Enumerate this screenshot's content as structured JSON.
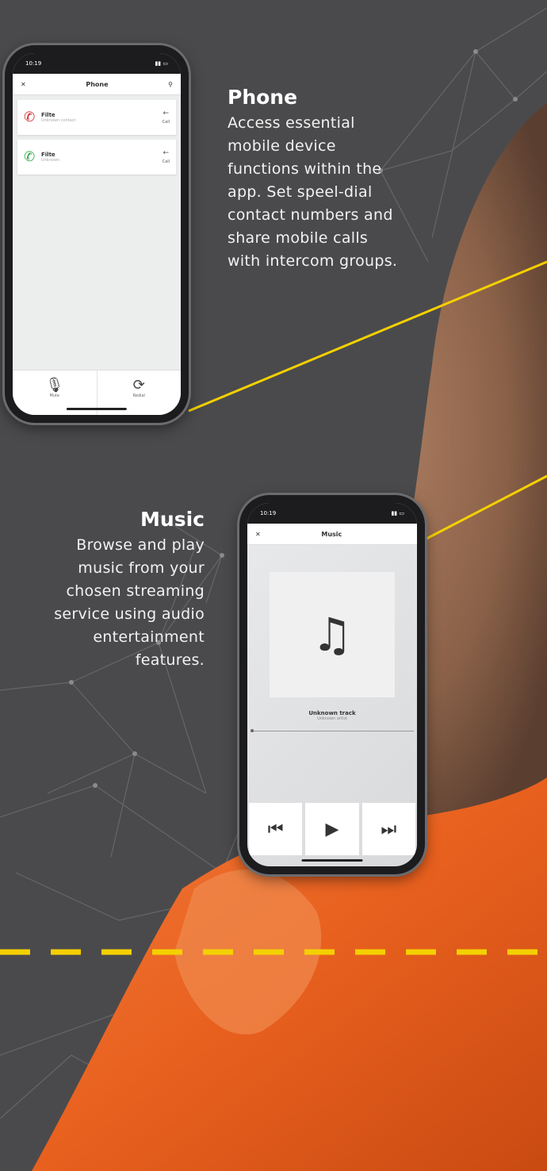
{
  "phone_section": {
    "title": "Phone",
    "description": "Access essential mobile device functions within the app. Set speel-dial contact numbers and share mobile calls with intercom groups.",
    "screen": {
      "status_time": "10:19",
      "header_title": "Phone",
      "rows": [
        {
          "icon": "missed-call-icon",
          "name": "Filte",
          "sub": "Unknown contact",
          "action": "Call"
        },
        {
          "icon": "call-icon",
          "name": "Filte",
          "sub": "Unknown",
          "action": "Call"
        }
      ],
      "bottom_left": "Mute",
      "bottom_right": "Redial"
    }
  },
  "music_section": {
    "title": "Music",
    "description": "Browse and play music from your chosen streaming service using audio entertainment features.",
    "screen": {
      "status_time": "10:19",
      "header_title": "Music",
      "track_title": "Unknown track",
      "track_artist": "Unknown artist"
    }
  },
  "colors": {
    "background": "#4a4a4c",
    "accent": "#f4d000",
    "vest": "#e8601e"
  }
}
